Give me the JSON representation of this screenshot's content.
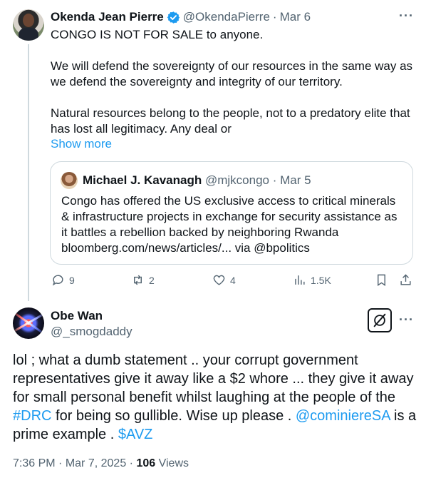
{
  "tweet": {
    "author_name": "Okenda Jean Pierre",
    "handle": "@OkendaPierre",
    "separator": "·",
    "date": "Mar 6",
    "lines": [
      "CONGO IS NOT FOR SALE to anyone.",
      "We will defend the sovereignty of our resources in the same way as we defend the sovereignty and integrity of our territory.",
      "Natural resources belong to the people, not to a predatory elite that has lost all legitimacy. Any deal or"
    ],
    "show_more": "Show more",
    "quote": {
      "author_name": "Michael J. Kavanagh",
      "handle": "@mjkcongo",
      "separator": "·",
      "date": "Mar 5",
      "text": "Congo has offered the US exclusive access to critical minerals & infrastructure projects in exchange for security assistance as it battles a rebellion backed by neighboring Rwanda bloomberg.com/news/articles/... via @bpolitics"
    },
    "actions": {
      "replies": "9",
      "reposts": "2",
      "likes": "4",
      "views": "1.5K"
    }
  },
  "reply": {
    "author_name": "Obe Wan",
    "handle": "@_smogdaddy",
    "text_part1": "lol ; what a dumb statement .. your corrupt government representatives  give it away like a $2 whore ... they give it away for small personal benefit whilst laughing at the people of the ",
    "hashtag": "#DRC",
    "text_part2": " for being so gullible. Wise up please . ",
    "mention": "@cominiereSA",
    "text_part3": " is a prime example . ",
    "cashtag": "$AVZ",
    "time": "7:36 PM",
    "separator": "·",
    "date": "Mar 7, 2025",
    "separator2": "·",
    "views_count": "106",
    "views_label": "Views"
  },
  "colors": {
    "accent": "#1d9bf0",
    "muted": "#536471",
    "text": "#0f1419",
    "border": "#cfd9de"
  },
  "icons": [
    "verified-badge-icon",
    "more-icon",
    "reply-icon",
    "repost-icon",
    "like-icon",
    "views-icon",
    "bookmark-icon",
    "share-icon",
    "grok-icon"
  ]
}
